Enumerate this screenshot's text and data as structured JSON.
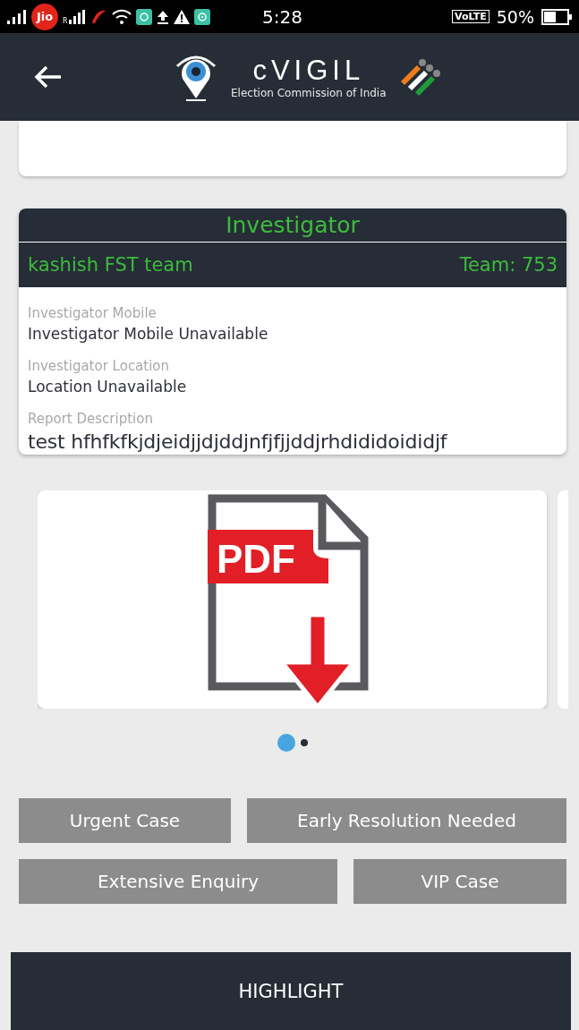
{
  "status_bar": {
    "carrier": "Jio",
    "roaming": "R",
    "time": "5:28",
    "volte": "VoLTE",
    "battery": "50%"
  },
  "header": {
    "title": "cVIGIL",
    "subtitle": "Election Commission of India"
  },
  "investigator": {
    "title": "Investigator",
    "team_name": "kashish FST team",
    "team_number": "Team: 753",
    "fields": [
      {
        "label": "Investigator Mobile",
        "value": "Investigator Mobile Unavailable",
        "kind": "small"
      },
      {
        "label": "Investigator Location",
        "value": "Location Unavailable",
        "kind": "small"
      },
      {
        "label": "Report Description",
        "value": "test hfhfkfkjdjeidjjdjddjnfjfjjddjrhdididoididjf",
        "kind": "large"
      }
    ]
  },
  "attachments": {
    "file_label": "PDF",
    "pages": [
      {
        "selected": true
      },
      {
        "selected": false
      }
    ]
  },
  "tags": [
    [
      {
        "label": "Urgent Case"
      },
      {
        "label": "Early Resolution Needed"
      }
    ],
    [
      {
        "label": "Extensive Enquiry"
      },
      {
        "label": "VIP Case"
      }
    ]
  ],
  "action": "HIGHLIGHT"
}
